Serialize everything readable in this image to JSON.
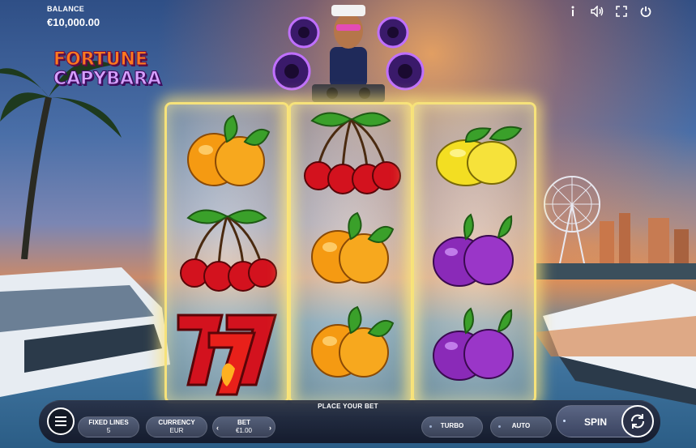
{
  "header": {
    "balance_label": "BALANCE",
    "balance_value": "€10,000.00"
  },
  "top_icons": [
    "info-icon",
    "sound-icon",
    "fullscreen-icon",
    "power-icon"
  ],
  "logo": {
    "line1": "FORTUNE",
    "line2": "CAPYBARA"
  },
  "reels": [
    [
      "orange",
      "cherries",
      "seven"
    ],
    [
      "cherries",
      "orange",
      "orange"
    ],
    [
      "lemon",
      "plum",
      "plum"
    ]
  ],
  "status": {
    "message": "PLACE YOUR BET"
  },
  "controls": {
    "fixed_lines_label": "FIXED LINES",
    "fixed_lines_value": "5",
    "currency_label": "CURRENCY",
    "currency_value": "EUR",
    "bet_label": "BET",
    "bet_value": "€1.00",
    "turbo_label": "TURBO",
    "auto_label": "AUTO",
    "spin_label": "SPIN"
  },
  "colors": {
    "reel_border": "#f6e27a",
    "orange": "#f59a12",
    "cherry": "#d3121e",
    "lemon": "#f3de22",
    "plum": "#8a2ab8",
    "leaf": "#3aa02a"
  }
}
